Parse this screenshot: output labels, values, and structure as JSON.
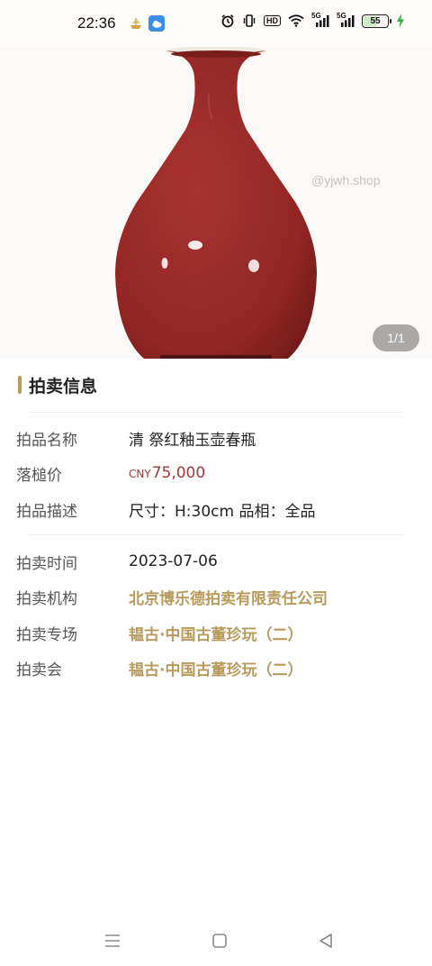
{
  "status_bar": {
    "time": "22:36",
    "icons": [
      "ship-icon",
      "weather-app-icon",
      "alarm-icon",
      "vibrate-icon",
      "hd-icon",
      "wifi-icon",
      "signal-5g-icon",
      "signal-5g-icon",
      "battery-icon",
      "charging-icon"
    ],
    "hd_label": "HD",
    "signal1_label": "5G",
    "signal2_label": "5G",
    "battery_level": "55",
    "battery_fraction": 0.55,
    "charging_color": "#3cb043"
  },
  "hero": {
    "watermark": "yjwh.shop",
    "page_indicator": "1/1",
    "vase_color": "#9b2a28"
  },
  "section": {
    "title": "拍卖信息",
    "accent": "#b89a5c"
  },
  "details": {
    "name_label": "拍品名称",
    "name_value": "清 祭红釉玉壶春瓶",
    "price_label": "落槌价",
    "price_currency": "CNY",
    "price_amount": "75,000",
    "price_color": "#a33a3a",
    "desc_label": "拍品描述",
    "desc_value": "尺寸：H:30cm 品相：全品",
    "time_label": "拍卖时间",
    "time_value": "2023-07-06",
    "org_label": "拍卖机构",
    "org_value": "北京博乐德拍卖有限责任公司",
    "special_label": "拍卖专场",
    "special_value": "韫古·中国古董珍玩（二）",
    "session_label": "拍卖会",
    "session_value": "韫古·中国古董珍玩（二）"
  },
  "nav": {
    "icons": [
      "menu-icon",
      "home-icon",
      "back-icon"
    ]
  }
}
